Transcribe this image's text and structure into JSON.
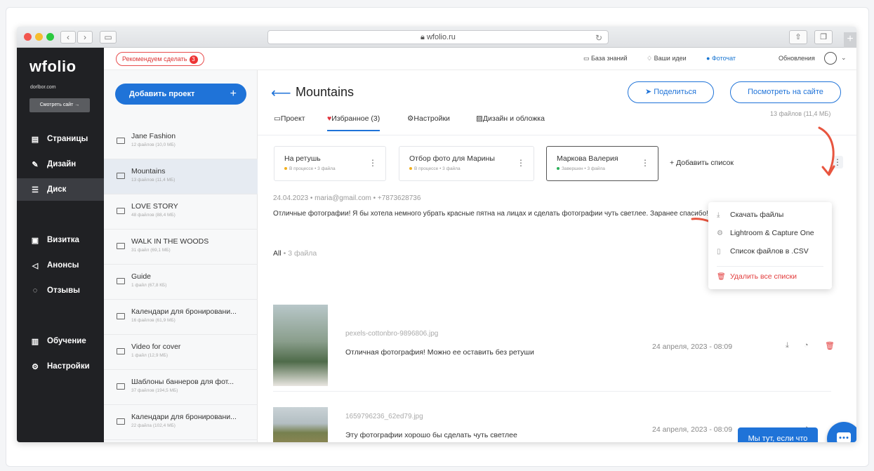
{
  "browser": {
    "url": "wfolio.ru",
    "lock_icon": "lock-icon"
  },
  "sidebar": {
    "logo": "wfolio",
    "domain": "dorlbor.com",
    "view_site": "Смотреть сайт →",
    "items": [
      {
        "label": "Страницы",
        "icon": "pages-icon"
      },
      {
        "label": "Дизайн",
        "icon": "brush-icon"
      },
      {
        "label": "Диск",
        "icon": "disk-icon",
        "active": true
      },
      {
        "label": "Визитка",
        "icon": "card-icon"
      },
      {
        "label": "Анонсы",
        "icon": "megaphone-icon"
      },
      {
        "label": "Отзывы",
        "icon": "reviews-icon"
      },
      {
        "label": "Обучение",
        "icon": "book-icon"
      },
      {
        "label": "Настройки",
        "icon": "gear-icon"
      }
    ]
  },
  "topbar": {
    "recommend_label": "Рекомендуем сделать",
    "recommend_badge": "3",
    "links": {
      "knowledge": "База знаний",
      "ideas": "Ваши идеи",
      "photochat": "Фоточат",
      "updates": "Обновления"
    }
  },
  "projects": {
    "add_label": "Добавить проект",
    "items": [
      {
        "name": "Jane Fashion",
        "meta": "12 файлов (10,0 МБ)"
      },
      {
        "name": "Mountains",
        "meta": "13 файлов (11,4 МБ)",
        "active": true
      },
      {
        "name": "LOVE STORY",
        "meta": "48 файлов (88,4 МБ)"
      },
      {
        "name": "WALK IN THE WOODS",
        "meta": "31 файл (69,1 МБ)"
      },
      {
        "name": "Guide",
        "meta": "1 файл (67,8 КБ)"
      },
      {
        "name": "Календари для бронировани...",
        "meta": "16 файлов (61,9 МБ)"
      },
      {
        "name": "Video for cover",
        "meta": "1 файл (12,9 МБ)"
      },
      {
        "name": "Шаблоны баннеров для фот...",
        "meta": "37 файлов (194,5 МБ)"
      },
      {
        "name": "Календари для бронировани...",
        "meta": "22 файла (102,4 МБ)"
      }
    ]
  },
  "main": {
    "title": "Mountains",
    "share_label": "Поделиться",
    "view_site_label": "Посмотреть на сайте",
    "files_count": "13 файлов (11,4 МБ)",
    "tabs": [
      {
        "label": "Проект"
      },
      {
        "label": "Избранное (3)",
        "active": true
      },
      {
        "label": "Настройки"
      },
      {
        "label": "Дизайн и обложка"
      }
    ],
    "lists": [
      {
        "name": "На ретушь",
        "status": "В процессе",
        "count": "3 файла",
        "color": "#f2b01e"
      },
      {
        "name": "Отбор фото для Марины",
        "status": "В процессе",
        "count": "3 файла",
        "color": "#f2b01e"
      },
      {
        "name": "Маркова Валерия",
        "status": "Завершен",
        "count": "3 файла",
        "color": "#2bb05a"
      }
    ],
    "add_list_label": "Добавить список",
    "comment": {
      "date": "24.04.2023",
      "email": "maria@gmail.com",
      "phone": "+7873628736",
      "text": "Отличные фотографии! Я бы хотела немного убрать красные пятна на лицах и сделать фотографии чуть светлее. Заранее спасибо!"
    },
    "filter": {
      "label": "All",
      "count": "3 файла"
    },
    "files": [
      {
        "name": "pexels-cottonbro-9896806.jpg",
        "note": "Отличная фотография! Можно ее оставить без ретуши",
        "date": "24 апреля, 2023 - 08:09"
      },
      {
        "name": "1659796236_62ed79.jpg",
        "note": "Эту фотографии хорошо бы сделать чуть светлее",
        "date": "24 апреля, 2023 - 08:09"
      }
    ]
  },
  "dropdown": {
    "items": [
      {
        "label": "Скачать файлы",
        "icon": "download-icon"
      },
      {
        "label": "Lightroom & Capture One",
        "icon": "gear-icon"
      },
      {
        "label": "Список файлов в .CSV",
        "icon": "file-icon"
      },
      {
        "label": "Удалить все списки",
        "icon": "trash-icon",
        "danger": true
      }
    ]
  },
  "chat": {
    "label": "Мы тут, если что"
  },
  "colors": {
    "accent": "#1f73d8",
    "sidebar": "#202124",
    "danger": "#e23c3c",
    "annotation": "#e8553f"
  }
}
